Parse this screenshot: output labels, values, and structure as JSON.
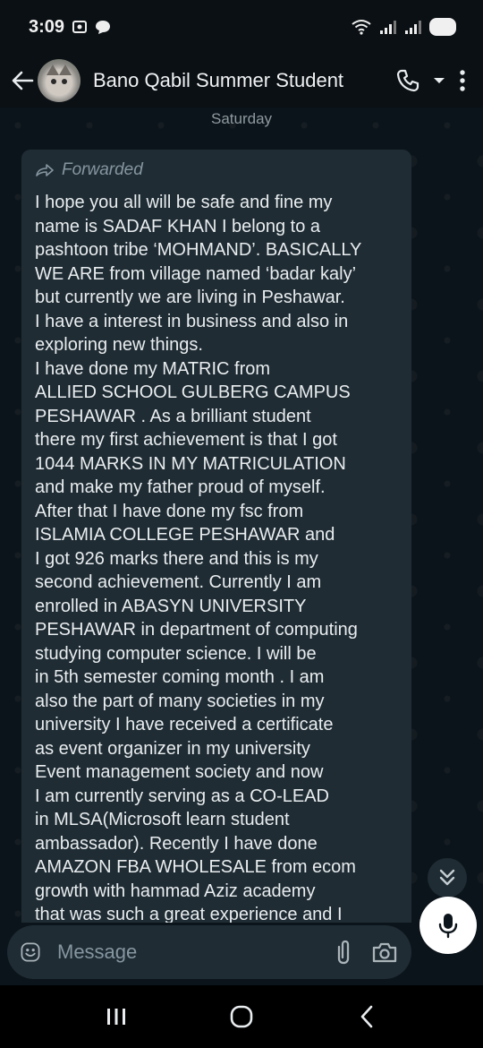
{
  "status_bar": {
    "time": "3:09"
  },
  "header": {
    "title": "Bano Qabil Summer Student"
  },
  "chat": {
    "date_label": "Saturday",
    "message": {
      "forwarded_label": "Forwarded",
      "text": "I hope you all will be safe and fine my\nname is SADAF KHAN I belong to a\npashtoon tribe ‘MOHMAND’. BASICALLY\nWE ARE from village named ‘badar kaly’\nbut currently we are living in Peshawar.\nI have a  interest in business and also in\nexploring new things.\nI have done my MATRIC from\nALLIED SCHOOL GULBERG CAMPUS\nPESHAWAR . As a brilliant student\nthere my first achievement is that I got\n1044 MARKS IN MY MATRICULATION\nand make my father proud of myself.\nAfter that I have done my fsc from\nISLAMIA COLLEGE PESHAWAR and\nI got 926 marks there and this is my\nsecond achievement. Currently I am\nenrolled in ABASYN UNIVERSITY\nPESHAWAR in department of computing\nstudying computer science. I will be\nin 5th semester coming month . I am\nalso the part of many societies in my\nuniversity  I have received a certificate\nas event organizer in my university\nEvent management society and now\nI am currently serving as a CO-LEAD\nin MLSA(Microsoft learn student\nambassador). Recently I have done\nAMAZON FBA WHOLESALE  from ecom\ngrowth with hammad Aziz academy\nthat was such a great experience and I"
    }
  },
  "composer": {
    "placeholder": "Message"
  },
  "colors": {
    "background": "#0b141a",
    "bubble": "#1f2c34",
    "text": "#e9edef",
    "muted": "#8696a0"
  },
  "icons": {
    "back": "arrow-left-icon",
    "call": "phone-icon",
    "dropdown": "caret-down-icon",
    "menu": "more-vertical-icon",
    "emoji": "emoji-icon",
    "attach": "paperclip-icon",
    "camera": "camera-icon",
    "mic": "microphone-icon",
    "scroll": "double-chevron-down-icon"
  }
}
